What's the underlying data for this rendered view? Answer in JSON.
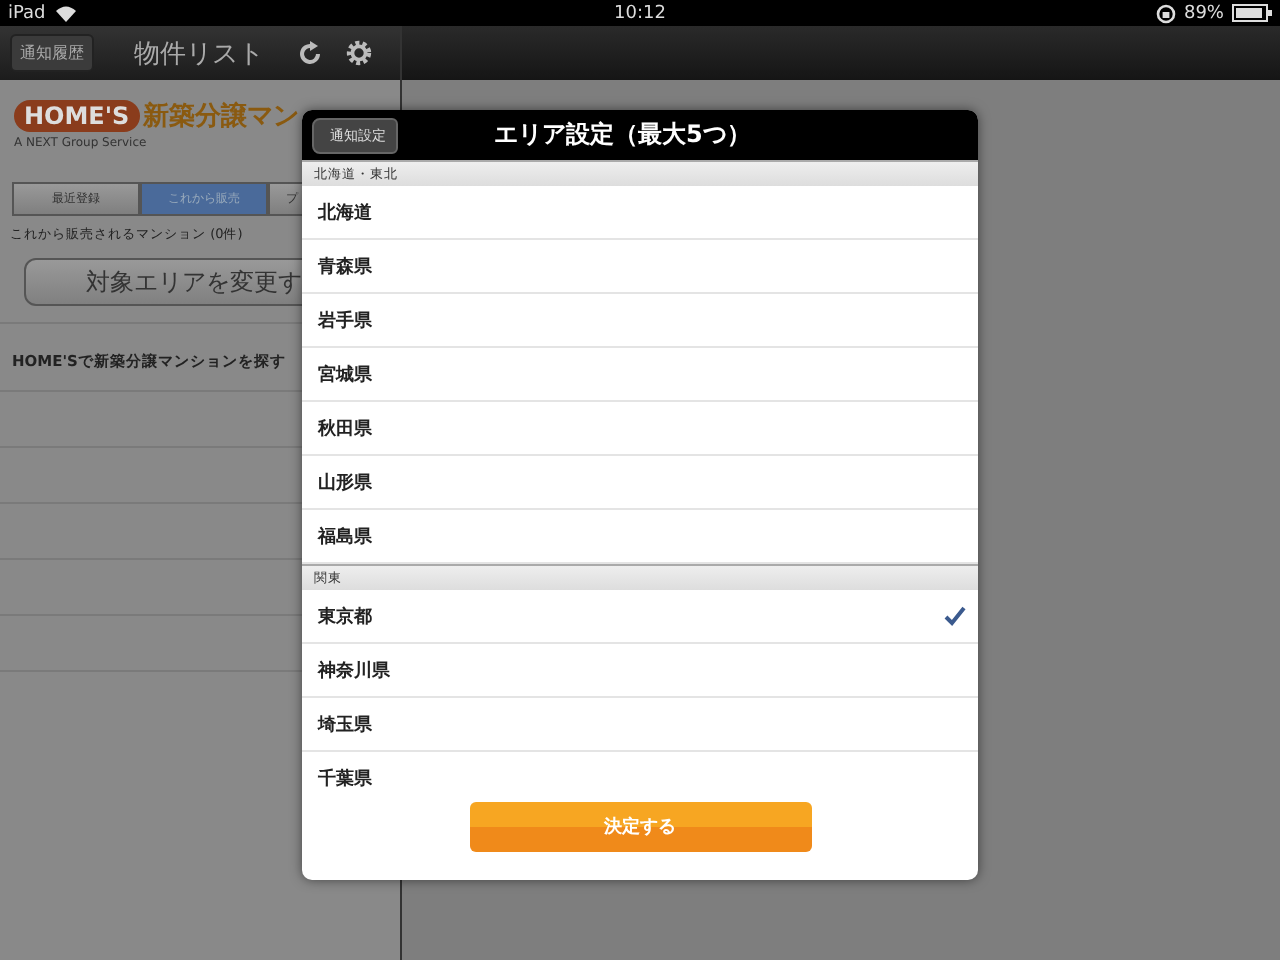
{
  "status_bar": {
    "carrier": "iPad",
    "time": "10:12",
    "battery": "89%"
  },
  "left_pane": {
    "history_button": "通知履歴",
    "title": "物件リスト",
    "logo": {
      "brand": "HOME'S",
      "tagline": "新築分譲マン",
      "subtitle": "A NEXT Group Service"
    },
    "segments": [
      {
        "label": "最近登録",
        "selected": false
      },
      {
        "label": "これから販売",
        "selected": true
      },
      {
        "label": "プ",
        "selected": false
      }
    ],
    "count_text": "これから販売されるマンション (0件)",
    "area_button": "対象エリアを変更す",
    "search_row": "HOME'Sで新築分譲マンションを探す"
  },
  "modal": {
    "back_button": "通知設定",
    "title": "エリア設定（最大5つ）",
    "sections": [
      {
        "header": "北海道・東北",
        "items": [
          {
            "label": "北海道",
            "checked": false
          },
          {
            "label": "青森県",
            "checked": false
          },
          {
            "label": "岩手県",
            "checked": false
          },
          {
            "label": "宮城県",
            "checked": false
          },
          {
            "label": "秋田県",
            "checked": false
          },
          {
            "label": "山形県",
            "checked": false
          },
          {
            "label": "福島県",
            "checked": false
          }
        ]
      },
      {
        "header": "関東",
        "items": [
          {
            "label": "東京都",
            "checked": true
          },
          {
            "label": "神奈川県",
            "checked": false
          },
          {
            "label": "埼玉県",
            "checked": false
          },
          {
            "label": "千葉県",
            "checked": false
          }
        ]
      }
    ],
    "confirm_button": "決定する"
  }
}
